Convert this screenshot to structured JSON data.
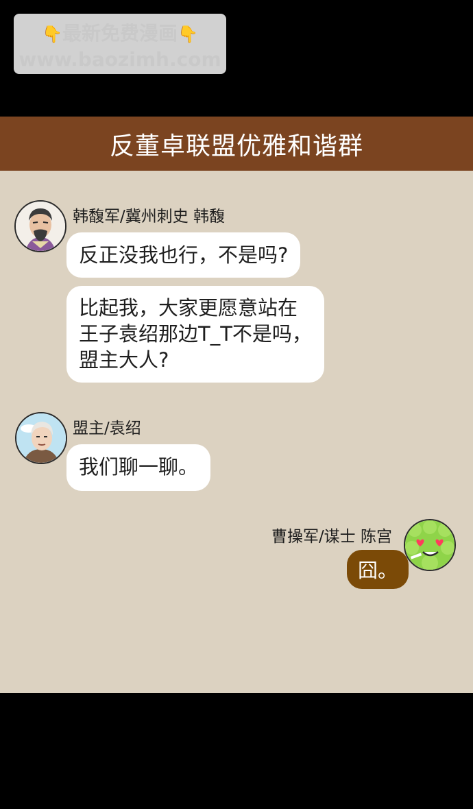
{
  "watermark": {
    "line1": "最新免费漫画",
    "line2": "www.baozimh.com",
    "hand_glyph": "👇"
  },
  "title": "反董卓联盟优雅和谐群",
  "colors": {
    "title_bar": "#7b4420",
    "chat_bg": "#dcd2c1",
    "own_bubble": "#7b4a07"
  },
  "messages": [
    {
      "sender": "韩馥军/冀州刺史 韩馥",
      "avatar": "han-fu-avatar",
      "bubbles": [
        "反正没我也行，不是吗?",
        "比起我，大家更愿意站在\n王子袁绍那边T_T不是吗，\n盟主大人?"
      ]
    },
    {
      "sender": "盟主/袁绍",
      "avatar": "yuan-shao-avatar",
      "bubbles": [
        "我们聊一聊。"
      ]
    },
    {
      "sender": "曹操军/谋士 陈宫",
      "avatar": "chen-gong-avatar",
      "bubbles": [
        "囧。"
      ]
    }
  ]
}
